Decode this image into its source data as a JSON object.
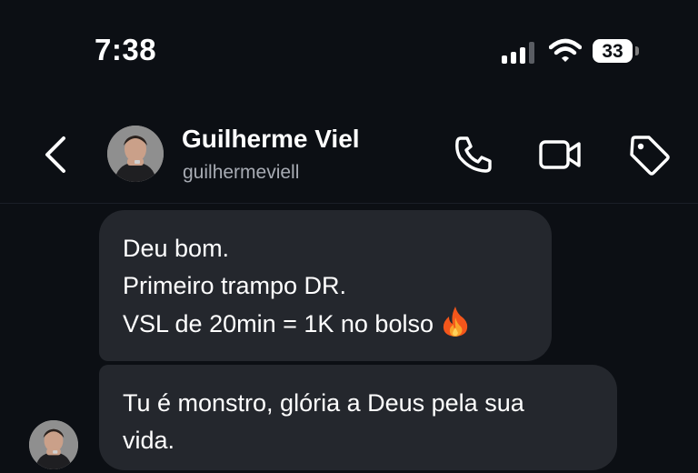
{
  "status_bar": {
    "time": "7:38",
    "battery_level": "33",
    "signal_icon": "cellular-signal-icon",
    "wifi_icon": "wifi-icon"
  },
  "header": {
    "name": "Guilherme Viel",
    "username": "guilhermeviell",
    "icons": [
      "back-chevron-icon",
      "phone-icon",
      "video-camera-icon",
      "tag-icon"
    ]
  },
  "messages": [
    {
      "lines": [
        "Deu bom.",
        "Primeiro trampo DR.",
        "VSL de 20min = 1K no bolso"
      ],
      "emoji": "fire-emoji-icon"
    },
    {
      "lines": [
        "Tu é monstro, glória a Deus pela sua",
        "vida."
      ]
    }
  ],
  "colors": {
    "background": "#0c0f14",
    "bubble": "#24272d",
    "secondary_text": "#a7abb3"
  }
}
